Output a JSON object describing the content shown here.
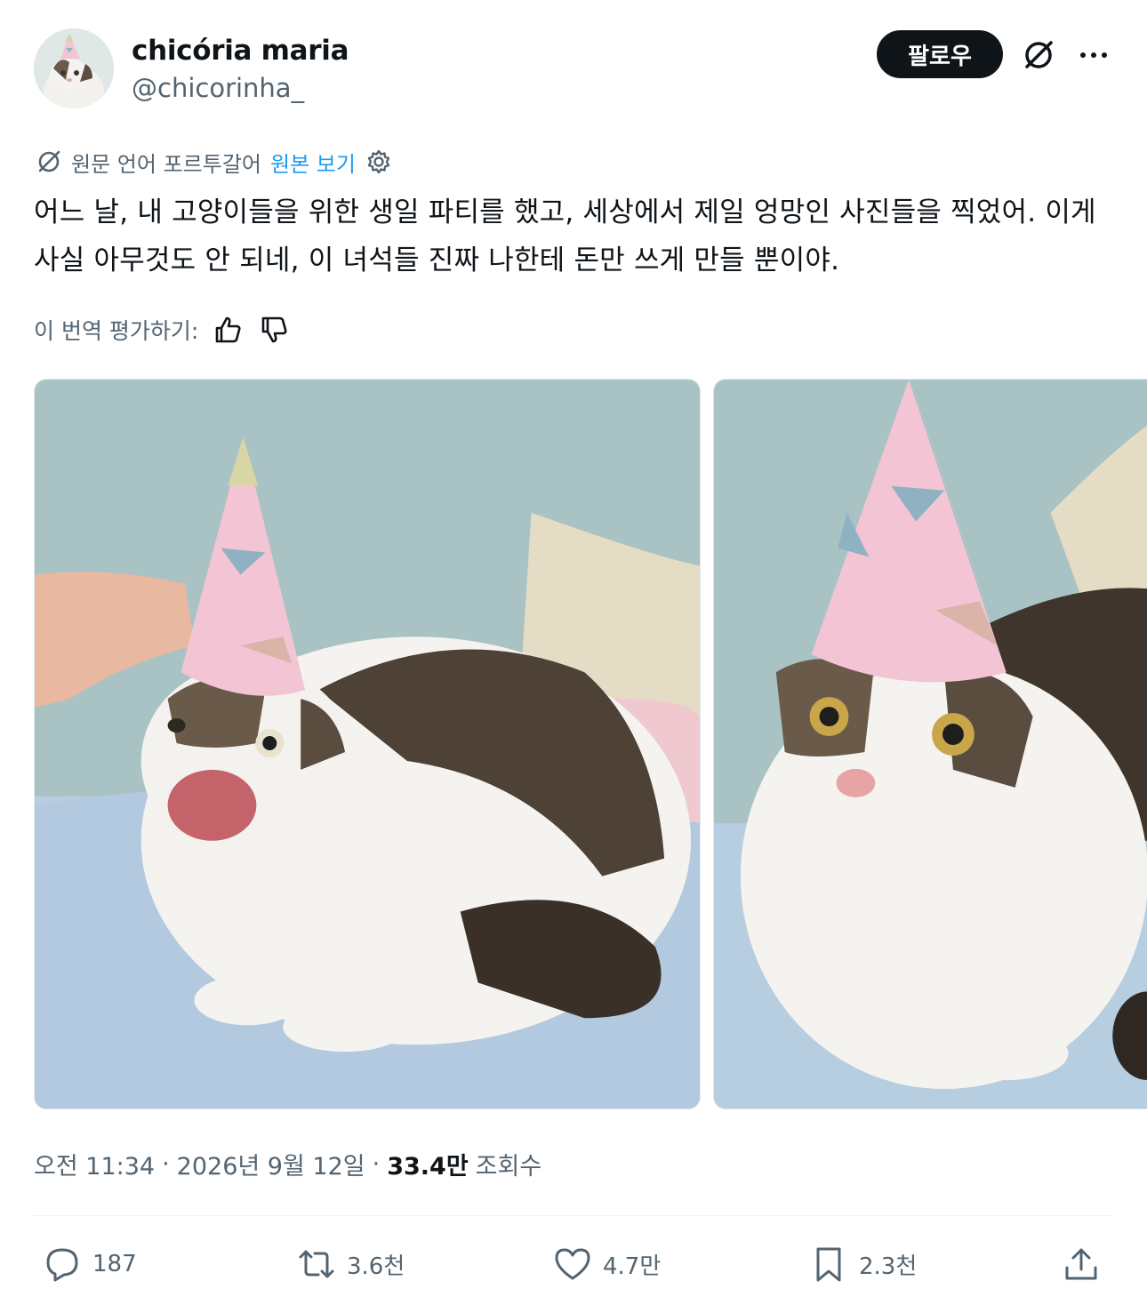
{
  "author": {
    "display_name": "chicória maria",
    "handle": "@chicorinha_"
  },
  "header": {
    "follow_label": "팔로우"
  },
  "translation": {
    "notice": "원문 언어 포르투갈어",
    "view_original": "원본 보기"
  },
  "tweet": {
    "text": "어느 날, 내 고양이들을 위한 생일 파티를 했고, 세상에서 제일 엉망인 사진들을 찍었어. 이게 사실 아무것도 안 되네, 이 녀석들 진짜 나한테 돈만 쓰게 만들 뿐이야."
  },
  "rating": {
    "label": "이 번역 평가하기:"
  },
  "meta": {
    "time": "오전 11:34",
    "date": "2026년 9월 12일",
    "views_count": "33.4만",
    "views_label": "조회수"
  },
  "actions": {
    "replies": "187",
    "reposts": "3.6천",
    "likes": "4.7만",
    "bookmarks": "2.3천"
  },
  "colors": {
    "text_primary": "#0f1419",
    "text_secondary": "#536471",
    "link": "#1d9bf0"
  }
}
